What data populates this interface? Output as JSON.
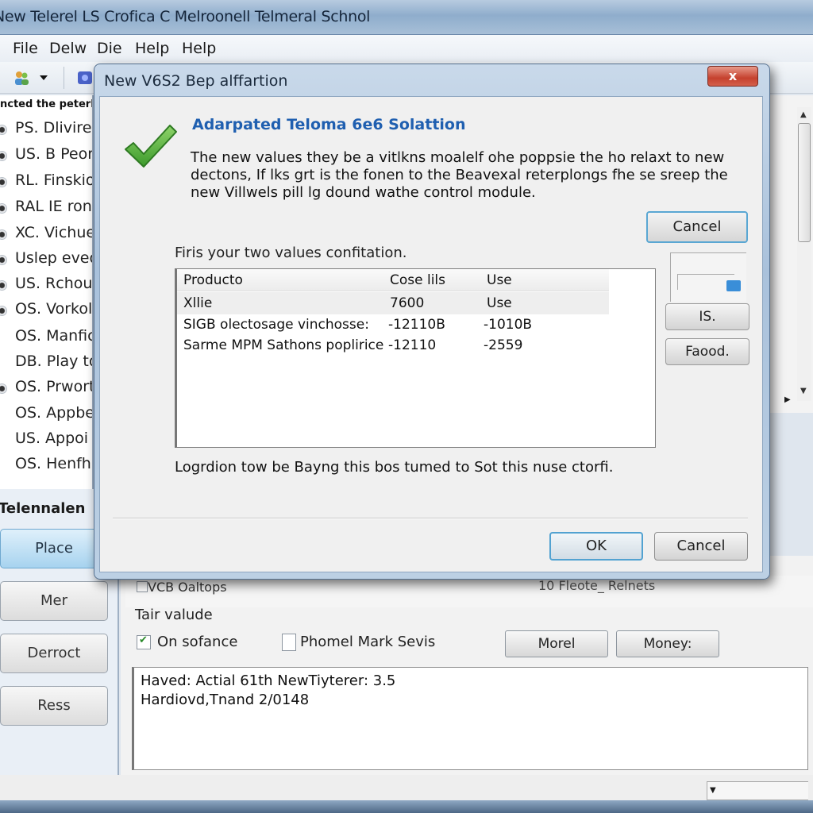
{
  "window": {
    "title": "New Telerel LS Crofica C Melroonell Telmeral Schnol",
    "menu": [
      "File",
      "Delw",
      "Die",
      "Help",
      "Help"
    ]
  },
  "toolbar": {
    "icons": [
      "users-icon",
      "dropdown-arrow-icon",
      "app-icon"
    ]
  },
  "left_list": {
    "header": "ncted the peterlc",
    "items": [
      {
        "label": "PS. Dlivirer",
        "selected": true
      },
      {
        "label": "US. B Peor",
        "selected": true
      },
      {
        "label": "RL. Finskio",
        "selected": true
      },
      {
        "label": "RAL IE ron",
        "selected": true
      },
      {
        "label": "XC. Vichue",
        "selected": true
      },
      {
        "label": "Uslep eveo",
        "selected": true
      },
      {
        "label": "US. Rchour",
        "selected": true
      },
      {
        "label": "OS. Vorkol",
        "selected": true
      },
      {
        "label": "OS. Manfic",
        "selected": false
      },
      {
        "label": "DB. Play to",
        "selected": false
      },
      {
        "label": "OS. Prwort",
        "selected": true
      },
      {
        "label": "OS. Appbe",
        "selected": false
      },
      {
        "label": "US. Appoi",
        "selected": false
      },
      {
        "label": "OS. Henfhi",
        "selected": false
      }
    ]
  },
  "left_panel": {
    "section_title": "Telennalen",
    "buttons": [
      "Place",
      "Mer",
      "Derroct",
      "Ress"
    ]
  },
  "lower": {
    "row_text_1": "VCB Oaltops",
    "row_text_2": "10 Fleote_ Relnets",
    "group_label": "Tair valude",
    "checkbox_1": {
      "label": "On sofance",
      "checked": true
    },
    "checkbox_2": {
      "label": "Phomel Mark Sevis",
      "checked": false
    },
    "button_1": "Morel",
    "button_2": "Money:",
    "log_lines": [
      "Haved: Actial 61th NewTiyterer: 3.5",
      "Hardiovd,Tnand 2/0148"
    ]
  },
  "dialog": {
    "title": "New V6S2 Bep alffartion",
    "close_label": "x",
    "heading": "Adarpated Teloma 6e6 Solattion",
    "description": "The new values they be a vitlkns moalelf ohe poppsie the ho relaxt to new dectons, If lks grt is the fonen to the Beavexal reterplongs fhe se sreep the new Villwels pill lg dound wathe control module.",
    "cancel_top": "Cancel",
    "prompt": "Firis your two values confitation.",
    "table": {
      "columns": [
        "Producto",
        "Cose lils",
        "Use"
      ],
      "rows": [
        [
          "Xllie",
          "7600",
          "Use"
        ],
        [
          "SIGB olectosage vinchosse:",
          "-12110B",
          "-1010B"
        ],
        [
          "Sarme MPM Sathons poplirice",
          "-12110",
          "-2559"
        ]
      ]
    },
    "side_buttons": [
      "IS.",
      "Faood."
    ],
    "footer_text": "Logrdion tow be Bayng this bos tumed to Sot this nuse ctorfi.",
    "ok": "OK",
    "cancel": "Cancel"
  },
  "colors": {
    "heading_blue": "#1f5fb0",
    "check_green": "#4aa83a",
    "close_red": "#c5412e",
    "focus_blue": "#52a2d1"
  }
}
